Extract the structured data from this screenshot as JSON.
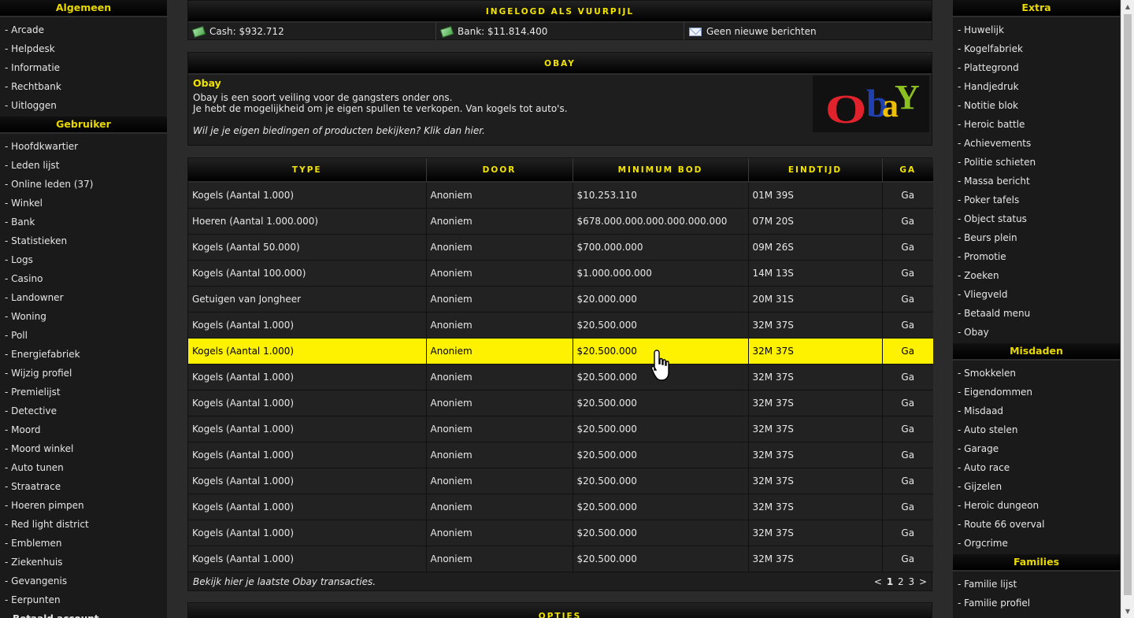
{
  "left_sidebar": {
    "sections": [
      {
        "title": "Algemeen",
        "items": [
          "Arcade",
          "Helpdesk",
          "Informatie",
          "Rechtbank",
          "Uitloggen"
        ]
      },
      {
        "title": "Gebruiker",
        "items": [
          "Hoofdkwartier",
          "Leden lijst",
          "Online leden (37)",
          "Winkel",
          "Bank",
          "Statistieken",
          "Logs",
          "Casino",
          "Landowner",
          "Woning",
          "Poll",
          "Energiefabriek",
          "Wijzig profiel",
          "Premielijst",
          "Detective",
          "Moord",
          "Moord winkel",
          "Auto tunen",
          "Straatrace",
          "Hoeren pimpen",
          "Red light district",
          "Emblemen",
          "Ziekenhuis",
          "Gevangenis",
          "Eerpunten"
        ]
      }
    ],
    "bold_item": "Betaald account"
  },
  "right_sidebar": {
    "sections": [
      {
        "title": "Extra",
        "items": [
          "Huwelijk",
          "Kogelfabriek",
          "Plattegrond",
          "Handjedruk",
          "Notitie blok",
          "Heroic battle",
          "Achievements",
          "Politie schieten",
          "Massa bericht",
          "Poker tafels",
          "Object status",
          "Beurs plein",
          "Promotie",
          "Zoeken",
          "Vliegveld",
          "Betaald menu",
          "Obay"
        ]
      },
      {
        "title": "Misdaden",
        "items": [
          "Smokkelen",
          "Eigendommen",
          "Misdaad",
          "Auto stelen",
          "Garage",
          "Auto race",
          "Gijzelen",
          "Heroic dungeon",
          "Route 66 overval",
          "Orgcrime"
        ]
      },
      {
        "title": "Families",
        "items": [
          "Familie lijst",
          "Familie profiel"
        ]
      }
    ]
  },
  "status": {
    "title": "INGELOGD ALS VUURPIJL",
    "cash": "Cash: $932.712",
    "bank": "Bank: $11.814.400",
    "messages": "Geen nieuwe berichten"
  },
  "obay": {
    "header": "OBAY",
    "title": "Obay",
    "line1": "Obay is een soort veiling voor de gangsters onder ons.",
    "line2": "Je hebt de mogelijkheid om je eigen spullen te verkopen. Van kogels tot auto's.",
    "link": "Wil je je eigen biedingen of producten bekijken? Klik dan hier.",
    "logo": {
      "o": "O",
      "b": "b",
      "a": "a",
      "y": "Y"
    }
  },
  "table": {
    "columns": [
      "TYPE",
      "DOOR",
      "MINIMUM BOD",
      "EINDTIJD",
      "GA"
    ],
    "rows": [
      [
        "Kogels (Aantal 1.000)",
        "Anoniem",
        "$10.253.110",
        "01M 39S",
        "Ga"
      ],
      [
        "Hoeren (Aantal 1.000.000)",
        "Anoniem",
        "$678.000.000.000.000.000.000",
        "07M 20S",
        "Ga"
      ],
      [
        "Kogels (Aantal 50.000)",
        "Anoniem",
        "$700.000.000",
        "09M 26S",
        "Ga"
      ],
      [
        "Kogels (Aantal 100.000)",
        "Anoniem",
        "$1.000.000.000",
        "14M 13S",
        "Ga"
      ],
      [
        "Getuigen van Jongheer",
        "Anoniem",
        "$20.000.000",
        "20M 31S",
        "Ga"
      ],
      [
        "Kogels (Aantal 1.000)",
        "Anoniem",
        "$20.500.000",
        "32M 37S",
        "Ga"
      ],
      [
        "Kogels (Aantal 1.000)",
        "Anoniem",
        "$20.500.000",
        "32M 37S",
        "Ga"
      ],
      [
        "Kogels (Aantal 1.000)",
        "Anoniem",
        "$20.500.000",
        "32M 37S",
        "Ga"
      ],
      [
        "Kogels (Aantal 1.000)",
        "Anoniem",
        "$20.500.000",
        "32M 37S",
        "Ga"
      ],
      [
        "Kogels (Aantal 1.000)",
        "Anoniem",
        "$20.500.000",
        "32M 37S",
        "Ga"
      ],
      [
        "Kogels (Aantal 1.000)",
        "Anoniem",
        "$20.500.000",
        "32M 37S",
        "Ga"
      ],
      [
        "Kogels (Aantal 1.000)",
        "Anoniem",
        "$20.500.000",
        "32M 37S",
        "Ga"
      ],
      [
        "Kogels (Aantal 1.000)",
        "Anoniem",
        "$20.500.000",
        "32M 37S",
        "Ga"
      ],
      [
        "Kogels (Aantal 1.000)",
        "Anoniem",
        "$20.500.000",
        "32M 37S",
        "Ga"
      ],
      [
        "Kogels (Aantal 1.000)",
        "Anoniem",
        "$20.500.000",
        "32M 37S",
        "Ga"
      ]
    ],
    "highlighted_row": 6,
    "footer_link": "Bekijk hier je laatste Obay transacties.",
    "pager": {
      "prev": "<",
      "pages": [
        "1",
        "2",
        "3"
      ],
      "current": "1",
      "next": ">"
    }
  },
  "options": {
    "header": "OPTIES"
  },
  "colors": {
    "accent": "#f2e400",
    "highlight": "#fff200",
    "sidebar_bg": "#1a1a1a",
    "page_bg": "#2b2b2b"
  },
  "icons": {
    "cash": "money-icon",
    "bank": "money-icon",
    "messages": "mail-icon",
    "pointer": "hand-cursor-icon"
  }
}
